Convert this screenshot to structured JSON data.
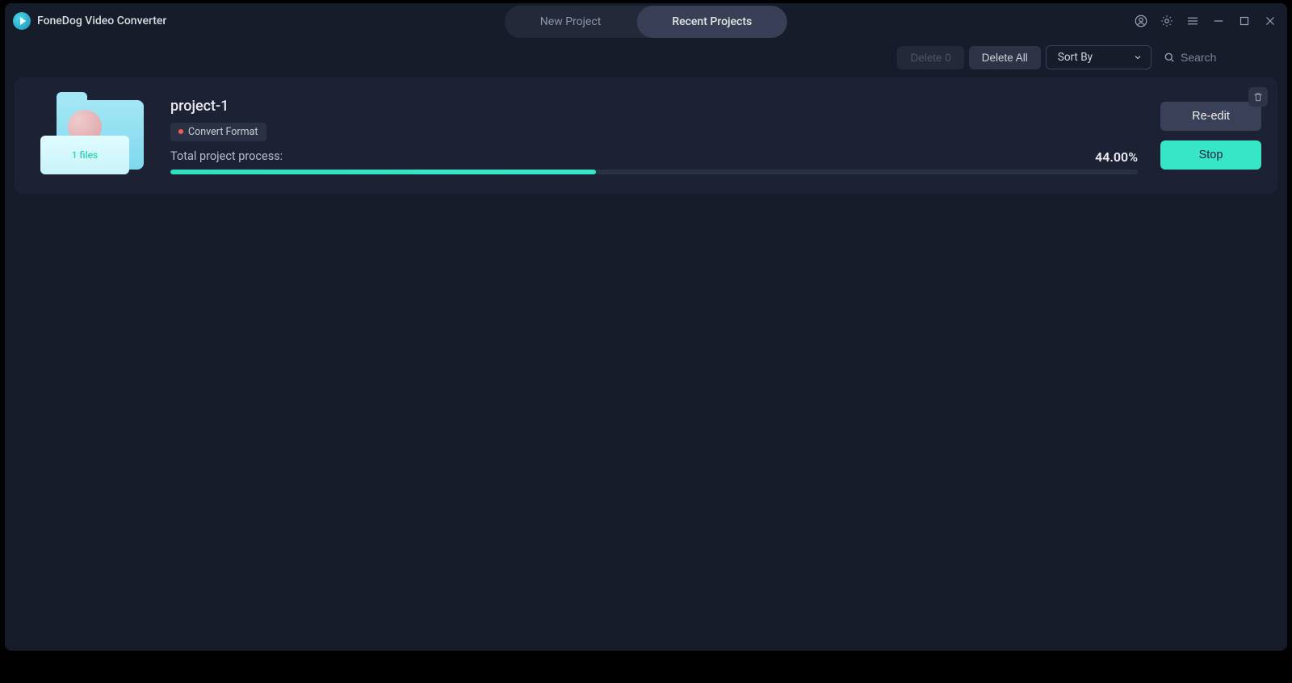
{
  "app": {
    "title": "FoneDog Video Converter"
  },
  "tabs": {
    "new": "New Project",
    "recent": "Recent Projects"
  },
  "toolbar": {
    "delete0": "Delete 0",
    "deleteAll": "Delete All",
    "sortBy": "Sort By",
    "searchPlaceholder": "Search"
  },
  "project": {
    "name": "project-1",
    "tag": "Convert Format",
    "filesLabel": "1 files",
    "progressLabel": "Total project process:",
    "progressPct": "44.00%",
    "progressValue": 44,
    "reedit": "Re-edit",
    "stop": "Stop"
  }
}
